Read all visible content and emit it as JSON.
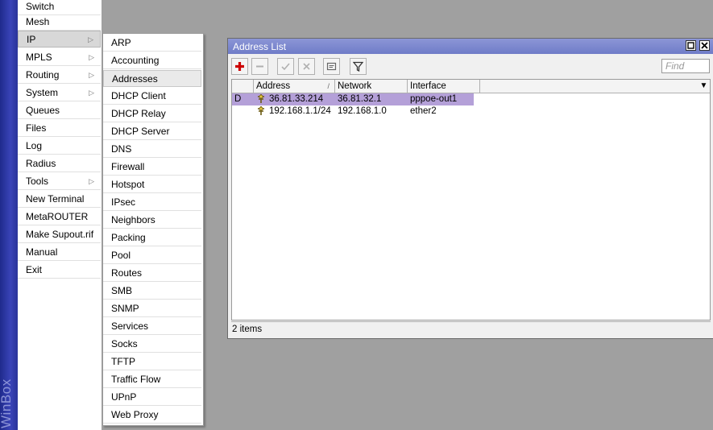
{
  "app": {
    "brand": "WinBox"
  },
  "main_menu": [
    {
      "label": "Switch",
      "has_submenu": false
    },
    {
      "label": "Mesh",
      "has_submenu": false
    },
    {
      "label": "IP",
      "has_submenu": true,
      "selected": true
    },
    {
      "label": "MPLS",
      "has_submenu": true
    },
    {
      "label": "Routing",
      "has_submenu": true
    },
    {
      "label": "System",
      "has_submenu": true
    },
    {
      "label": "Queues",
      "has_submenu": false
    },
    {
      "label": "Files",
      "has_submenu": false
    },
    {
      "label": "Log",
      "has_submenu": false
    },
    {
      "label": "Radius",
      "has_submenu": false
    },
    {
      "label": "Tools",
      "has_submenu": true
    },
    {
      "label": "New Terminal",
      "has_submenu": false
    },
    {
      "label": "MetaROUTER",
      "has_submenu": false
    },
    {
      "label": "Make Supout.rif",
      "has_submenu": false
    },
    {
      "label": "Manual",
      "has_submenu": false
    },
    {
      "label": "Exit",
      "has_submenu": false
    }
  ],
  "ip_submenu": [
    "ARP",
    "Accounting",
    "Addresses",
    "DHCP Client",
    "DHCP Relay",
    "DHCP Server",
    "DNS",
    "Firewall",
    "Hotspot",
    "IPsec",
    "Neighbors",
    "Packing",
    "Pool",
    "Routes",
    "SMB",
    "SNMP",
    "Services",
    "Socks",
    "TFTP",
    "Traffic Flow",
    "UPnP",
    "Web Proxy"
  ],
  "ip_submenu_selected": "Addresses",
  "address_window": {
    "title": "Address List",
    "find_placeholder": "Find",
    "columns": [
      "Address",
      "Network",
      "Interface"
    ],
    "sort_indicator": "/",
    "rows": [
      {
        "flag": "D",
        "address": "36.81.33.214",
        "network": "36.81.32.1",
        "interface": "pppoe-out1",
        "highlighted": true
      },
      {
        "flag": "",
        "address": "192.168.1.1/24",
        "network": "192.168.1.0",
        "interface": "ether2",
        "highlighted": false
      }
    ],
    "status": "2 items"
  },
  "colors": {
    "title_bar": "#7b86cf",
    "row_highlight": "#b4a0d8",
    "add_icon": "#cc0000",
    "desktop": "#a0a0a0",
    "strip": "#2a3499"
  }
}
